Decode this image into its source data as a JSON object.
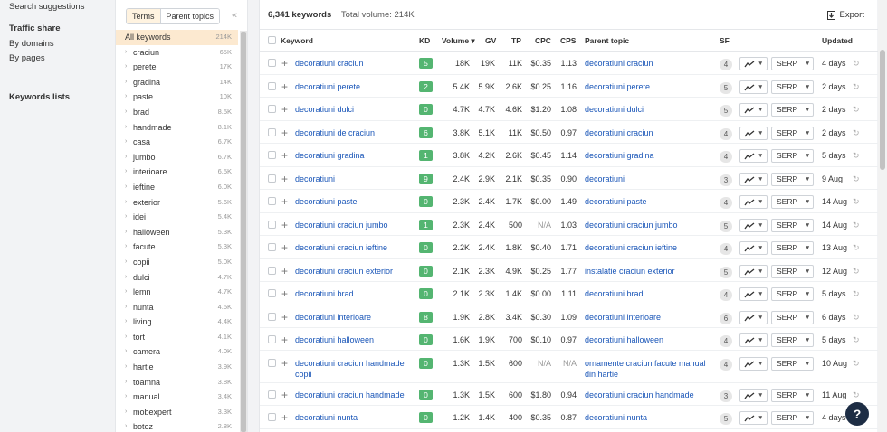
{
  "nav": {
    "search_suggestions": "Search suggestions",
    "traffic_share": "Traffic share",
    "by_domains": "By domains",
    "by_pages": "By pages",
    "keywords_lists": "Keywords lists"
  },
  "filter": {
    "terms_tab": "Terms",
    "parent_topics_tab": "Parent topics",
    "collapse_icon": "«",
    "all": {
      "name": "All keywords",
      "count": "214K"
    },
    "items": [
      {
        "name": "craciun",
        "count": "65K"
      },
      {
        "name": "perete",
        "count": "17K"
      },
      {
        "name": "gradina",
        "count": "14K"
      },
      {
        "name": "paste",
        "count": "10K"
      },
      {
        "name": "brad",
        "count": "8.5K"
      },
      {
        "name": "handmade",
        "count": "8.1K"
      },
      {
        "name": "casa",
        "count": "6.7K"
      },
      {
        "name": "jumbo",
        "count": "6.7K"
      },
      {
        "name": "interioare",
        "count": "6.5K"
      },
      {
        "name": "ieftine",
        "count": "6.0K"
      },
      {
        "name": "exterior",
        "count": "5.6K"
      },
      {
        "name": "idei",
        "count": "5.4K"
      },
      {
        "name": "halloween",
        "count": "5.3K"
      },
      {
        "name": "facute",
        "count": "5.3K"
      },
      {
        "name": "copii",
        "count": "5.0K"
      },
      {
        "name": "dulci",
        "count": "4.7K"
      },
      {
        "name": "lemn",
        "count": "4.7K"
      },
      {
        "name": "nunta",
        "count": "4.5K"
      },
      {
        "name": "living",
        "count": "4.4K"
      },
      {
        "name": "tort",
        "count": "4.1K"
      },
      {
        "name": "camera",
        "count": "4.0K"
      },
      {
        "name": "hartie",
        "count": "3.9K"
      },
      {
        "name": "toamna",
        "count": "3.8K"
      },
      {
        "name": "manual",
        "count": "3.4K"
      },
      {
        "name": "mobexpert",
        "count": "3.3K"
      },
      {
        "name": "botez",
        "count": "2.8K"
      }
    ]
  },
  "summary": {
    "keywords_count": "6,341 keywords",
    "total_volume": "Total volume: 214K"
  },
  "export_label": "Export",
  "headers": {
    "keyword": "Keyword",
    "kd": "KD",
    "volume": "Volume ▾",
    "gv": "GV",
    "tp": "TP",
    "cpc": "CPC",
    "cps": "CPS",
    "parent_topic": "Parent topic",
    "sf": "SF",
    "updated": "Updated"
  },
  "serp_label": "SERP",
  "colors": {
    "kd_easy": "#54b571",
    "kd_low": "#8fd196",
    "link": "#1a56b8",
    "accent_bg": "#fce9d0"
  },
  "rows": [
    {
      "keyword": "decoratiuni craciun",
      "kd": "5",
      "volume": "18K",
      "gv": "19K",
      "tp": "11K",
      "cpc": "$0.35",
      "cps": "1.13",
      "parent": "decoratiuni craciun",
      "sf": "4",
      "updated": "4 days"
    },
    {
      "keyword": "decoratiuni perete",
      "kd": "2",
      "volume": "5.4K",
      "gv": "5.9K",
      "tp": "2.6K",
      "cpc": "$0.25",
      "cps": "1.16",
      "parent": "decoratiuni perete",
      "sf": "5",
      "updated": "2 days"
    },
    {
      "keyword": "decoratiuni dulci",
      "kd": "0",
      "volume": "4.7K",
      "gv": "4.7K",
      "tp": "4.6K",
      "cpc": "$1.20",
      "cps": "1.08",
      "parent": "decoratiuni dulci",
      "sf": "5",
      "updated": "2 days"
    },
    {
      "keyword": "decoratiuni de craciun",
      "kd": "6",
      "volume": "3.8K",
      "gv": "5.1K",
      "tp": "11K",
      "cpc": "$0.50",
      "cps": "0.97",
      "parent": "decoratiuni craciun",
      "sf": "4",
      "updated": "2 days"
    },
    {
      "keyword": "decoratiuni gradina",
      "kd": "1",
      "volume": "3.8K",
      "gv": "4.2K",
      "tp": "2.6K",
      "cpc": "$0.45",
      "cps": "1.14",
      "parent": "decoratiuni gradina",
      "sf": "4",
      "updated": "5 days"
    },
    {
      "keyword": "decoratiuni",
      "kd": "9",
      "volume": "2.4K",
      "gv": "2.9K",
      "tp": "2.1K",
      "cpc": "$0.35",
      "cps": "0.90",
      "parent": "decoratiuni",
      "sf": "3",
      "updated": "9 Aug"
    },
    {
      "keyword": "decoratiuni paste",
      "kd": "0",
      "volume": "2.3K",
      "gv": "2.4K",
      "tp": "1.7K",
      "cpc": "$0.00",
      "cps": "1.49",
      "parent": "decoratiuni paste",
      "sf": "4",
      "updated": "14 Aug"
    },
    {
      "keyword": "decoratiuni craciun jumbo",
      "kd": "1",
      "volume": "2.3K",
      "gv": "2.4K",
      "tp": "500",
      "cpc": "N/A",
      "cps": "1.03",
      "parent": "decoratiuni craciun jumbo",
      "sf": "5",
      "updated": "14 Aug"
    },
    {
      "keyword": "decoratiuni craciun ieftine",
      "kd": "0",
      "volume": "2.2K",
      "gv": "2.4K",
      "tp": "1.8K",
      "cpc": "$0.40",
      "cps": "1.71",
      "parent": "decoratiuni craciun ieftine",
      "sf": "4",
      "updated": "13 Aug"
    },
    {
      "keyword": "decoratiuni craciun exterior",
      "kd": "0",
      "volume": "2.1K",
      "gv": "2.3K",
      "tp": "4.9K",
      "cpc": "$0.25",
      "cps": "1.77",
      "parent": "instalatie craciun exterior",
      "sf": "5",
      "updated": "12 Aug"
    },
    {
      "keyword": "decoratiuni brad",
      "kd": "0",
      "volume": "2.1K",
      "gv": "2.3K",
      "tp": "1.4K",
      "cpc": "$0.00",
      "cps": "1.11",
      "parent": "decoratiuni brad",
      "sf": "4",
      "updated": "5 days"
    },
    {
      "keyword": "decoratiuni interioare",
      "kd": "8",
      "volume": "1.9K",
      "gv": "2.8K",
      "tp": "3.4K",
      "cpc": "$0.30",
      "cps": "1.09",
      "parent": "decoratiuni interioare",
      "sf": "6",
      "updated": "6 days"
    },
    {
      "keyword": "decoratiuni halloween",
      "kd": "0",
      "volume": "1.6K",
      "gv": "1.9K",
      "tp": "700",
      "cpc": "$0.10",
      "cps": "0.97",
      "parent": "decoratiuni halloween",
      "sf": "4",
      "updated": "5 days"
    },
    {
      "keyword": "decoratiuni craciun handmade copii",
      "kd": "0",
      "volume": "1.3K",
      "gv": "1.5K",
      "tp": "600",
      "cpc": "N/A",
      "cps": "N/A",
      "parent": "ornamente craciun facute manual din hartie",
      "sf": "4",
      "updated": "10 Aug"
    },
    {
      "keyword": "decoratiuni craciun handmade",
      "kd": "0",
      "volume": "1.3K",
      "gv": "1.5K",
      "tp": "600",
      "cpc": "$1.80",
      "cps": "0.94",
      "parent": "decoratiuni craciun handmade",
      "sf": "3",
      "updated": "11 Aug"
    },
    {
      "keyword": "decoratiuni nunta",
      "kd": "0",
      "volume": "1.2K",
      "gv": "1.4K",
      "tp": "400",
      "cpc": "$0.35",
      "cps": "0.87",
      "parent": "decoratiuni nunta",
      "sf": "5",
      "updated": "4 days"
    }
  ],
  "help_label": "?"
}
